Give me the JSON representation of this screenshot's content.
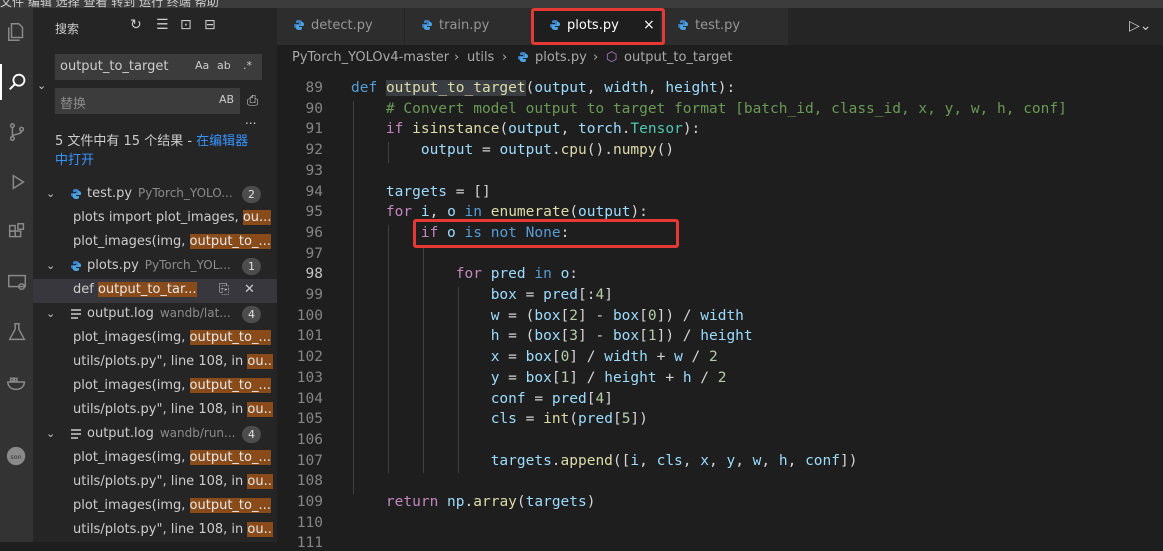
{
  "menubar": {
    "text": "文件  编辑  选择  查看  转到  运行  终端  帮助"
  },
  "sidebar": {
    "title": "搜索",
    "search_value": "output_to_target",
    "search_opts": {
      "case": "Aa",
      "word": "ab",
      "regex": ".*"
    },
    "replace_placeholder": "替换",
    "replace_opt": "AB",
    "more": "...",
    "summary_prefix": "5 文件中有 15 个结果 - ",
    "summary_link": "在编辑器中打开",
    "results": [
      {
        "type": "file",
        "name": "test.py",
        "path": "PyTorch_YOLO...",
        "count": "2",
        "icon": "python-icon"
      },
      {
        "type": "match",
        "pre": "plots import plot_images, ",
        "hit": "ou..."
      },
      {
        "type": "match",
        "pre": "plot_images(img, ",
        "hit": "output_to_..."
      },
      {
        "type": "file",
        "name": "plots.py",
        "path": "PyTorch_YOL...",
        "count": "1",
        "icon": "python-icon"
      },
      {
        "type": "match",
        "pre": "def ",
        "hit": "output_to_tar...",
        "selected": true
      },
      {
        "type": "file",
        "name": "output.log",
        "path": "wandb/lat...",
        "count": "4",
        "icon": "list-icon"
      },
      {
        "type": "match",
        "pre": "plot_images(img, ",
        "hit": "output_to_..."
      },
      {
        "type": "match",
        "pre": "utils/plots.py\", line 108, in ",
        "hit": "ou..."
      },
      {
        "type": "match",
        "pre": "plot_images(img, ",
        "hit": "output_to_..."
      },
      {
        "type": "match",
        "pre": "utils/plots.py\", line 108, in ",
        "hit": "ou..."
      },
      {
        "type": "file",
        "name": "output.log",
        "path": "wandb/run...",
        "count": "4",
        "icon": "list-icon"
      },
      {
        "type": "match",
        "pre": "plot_images(img, ",
        "hit": "output_to_..."
      },
      {
        "type": "match",
        "pre": "utils/plots.py\", line 108, in ",
        "hit": "ou..."
      },
      {
        "type": "match",
        "pre": "plot_images(img, ",
        "hit": "output_to_..."
      },
      {
        "type": "match",
        "pre": "utils/plots.py\", line 108, in ",
        "hit": "ou..."
      }
    ]
  },
  "tabs": [
    {
      "label": "detect.py",
      "active": false
    },
    {
      "label": "train.py",
      "active": false
    },
    {
      "label": "plots.py",
      "active": true
    },
    {
      "label": "test.py",
      "active": false
    }
  ],
  "tab_close": "×",
  "breadcrumb": [
    "PyTorch_YOLOv4-master",
    "utils",
    "plots.py",
    "output_to_target"
  ],
  "code": {
    "current_line": 98,
    "lines": [
      {
        "n": 89,
        "t": "def output_to_target(output, width, height):"
      },
      {
        "n": 90,
        "t": "    # Convert model output to target format [batch_id, class_id, x, y, w, h, conf]"
      },
      {
        "n": 91,
        "t": "    if isinstance(output, torch.Tensor):"
      },
      {
        "n": 92,
        "t": "        output = output.cpu().numpy()"
      },
      {
        "n": 93,
        "t": ""
      },
      {
        "n": 94,
        "t": "    targets = []"
      },
      {
        "n": 95,
        "t": "    for i, o in enumerate(output):"
      },
      {
        "n": 96,
        "t": "        if o is not None:"
      },
      {
        "n": 97,
        "t": ""
      },
      {
        "n": 98,
        "t": "            for pred in o:"
      },
      {
        "n": 99,
        "t": "                box = pred[:4]"
      },
      {
        "n": 100,
        "t": "                w = (box[2] - box[0]) / width"
      },
      {
        "n": 101,
        "t": "                h = (box[3] - box[1]) / height"
      },
      {
        "n": 102,
        "t": "                x = box[0] / width + w / 2"
      },
      {
        "n": 103,
        "t": "                y = box[1] / height + h / 2"
      },
      {
        "n": 104,
        "t": "                conf = pred[4]"
      },
      {
        "n": 105,
        "t": "                cls = int(pred[5])"
      },
      {
        "n": 106,
        "t": ""
      },
      {
        "n": 107,
        "t": "                targets.append([i, cls, x, y, w, h, conf])"
      },
      {
        "n": 108,
        "t": ""
      },
      {
        "n": 109,
        "t": "    return np.array(targets)"
      },
      {
        "n": 110,
        "t": ""
      },
      {
        "n": 111,
        "t": ""
      }
    ]
  },
  "colors": {
    "accent": "#3794ff",
    "highlight_box": "#e53935",
    "match_bg": "#8a4b1a"
  }
}
